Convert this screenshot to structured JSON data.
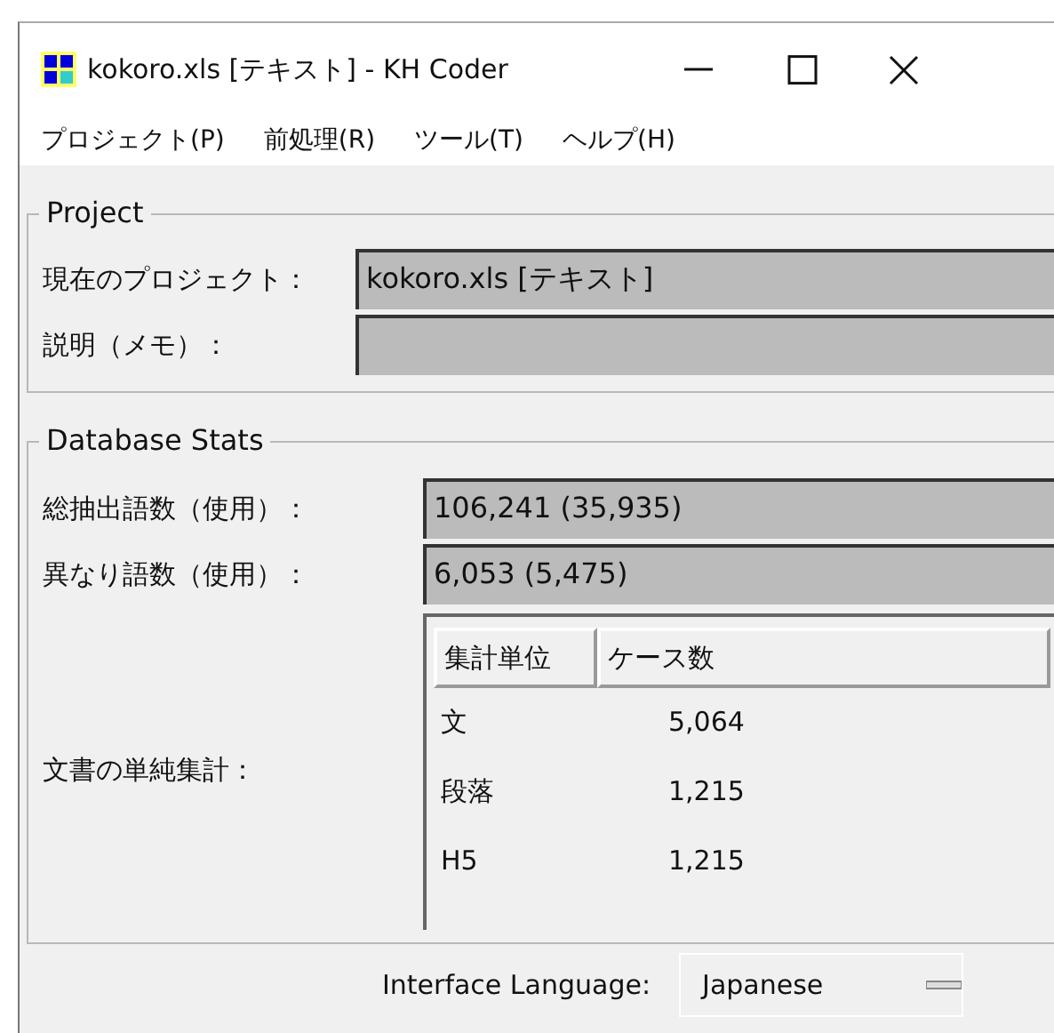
{
  "window": {
    "title": "kokoro.xls [テキスト] - KH Coder"
  },
  "menu": [
    {
      "label": "プロジェクト(P)"
    },
    {
      "label": "前処理(R)"
    },
    {
      "label": "ツール(T)"
    },
    {
      "label": "ヘルプ(H)"
    }
  ],
  "project": {
    "legend": "Project",
    "fields": [
      {
        "label": "現在のプロジェクト：",
        "value": "kokoro.xls [テキスト]"
      },
      {
        "label": "説明（メモ）："
      }
    ]
  },
  "database_stats": {
    "legend": "Database Stats",
    "fields": [
      {
        "label": "総抽出語数（使用）：",
        "value": "106,241 (35,935)"
      },
      {
        "label": "異なり語数（使用）：",
        "value": "6,053 (5,475)"
      }
    ],
    "document_counts": {
      "label": "文書の単純集計：",
      "columns": [
        "集計単位",
        "ケース数"
      ],
      "rows": [
        [
          "文",
          "5,064"
        ],
        [
          "段落",
          "1,215"
        ],
        [
          "H5",
          "1,215"
        ]
      ]
    }
  },
  "footer": {
    "label": "Interface Language:",
    "value": "Japanese"
  }
}
